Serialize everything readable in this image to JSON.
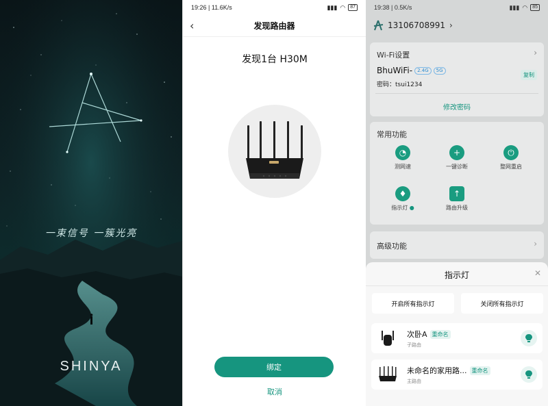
{
  "splash": {
    "slogan": "一束信号  一簇光亮",
    "brand": "SHINYA"
  },
  "discover": {
    "status": {
      "time": "19:26",
      "speed": "11.6K/s",
      "battery": "87"
    },
    "nav_title": "发现路由器",
    "found_text": "发现1台 H30M",
    "bind_label": "绑定",
    "cancel_label": "取消"
  },
  "dashboard": {
    "status": {
      "time": "19:38",
      "speed": "0.5K/s",
      "battery": "85"
    },
    "account": "13106708991",
    "wifi": {
      "title": "Wi-Fi设置",
      "ssid": "BhuWiFi-",
      "band_24": "2.4G",
      "band_5": "5G",
      "copy_label": "复制",
      "password_label": "密码：",
      "password": "tsui1234",
      "change_label": "修改密码"
    },
    "functions": {
      "title": "常用功能",
      "items": [
        {
          "label": "测网速",
          "icon": "speedometer-icon"
        },
        {
          "label": "一键诊断",
          "icon": "diagnose-plus-icon"
        },
        {
          "label": "整网重启",
          "icon": "power-icon"
        },
        {
          "label": "指示灯",
          "icon": "bulb-icon"
        },
        {
          "label": "路由升级",
          "icon": "upgrade-icon"
        }
      ]
    },
    "advanced": "高级功能"
  },
  "sheet": {
    "title": "指示灯",
    "btn_on": "开启所有指示灯",
    "btn_off": "关闭所有指示灯",
    "devices": [
      {
        "name": "次卧A",
        "rename": "重命名",
        "role": "子路由"
      },
      {
        "name": "未命名的家用路...",
        "rename": "重命名",
        "role": "主路由"
      }
    ]
  },
  "colors": {
    "accent": "#16957f",
    "sheet_bg": "#f7f7f7"
  }
}
